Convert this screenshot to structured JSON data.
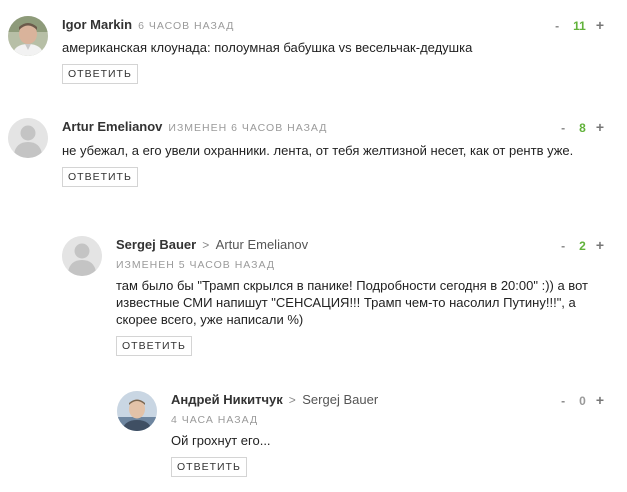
{
  "reply_label": "ОТВЕТИТЬ",
  "colors": {
    "positive": "#61b23a",
    "neutral": "#999999"
  },
  "comments": [
    {
      "author": "Igor Markin",
      "time": "6 ЧАСОВ НАЗАД",
      "text": "американская клоунада: полоумная бабушка vs весельчак-дедушка",
      "score": "11",
      "minus": "-",
      "plus": "+",
      "avatar": "photo"
    },
    {
      "author": "Artur Emelianov",
      "time": "ИЗМЕНЕН 6 ЧАСОВ НАЗАД",
      "text": "не убежал, а его увели охранники. лента, от тебя желтизной несет, как от рентв уже.",
      "score": "8",
      "minus": "-",
      "plus": "+",
      "avatar": "default-user-icon"
    },
    {
      "author": "Sergej Bauer",
      "reply_arrow": ">",
      "reply_to": "Artur Emelianov",
      "time": "ИЗМЕНЕН 5 ЧАСОВ НАЗАД",
      "text": "там было бы \"Трамп скрылся в панике! Подробности сегодня в 20:00\" :)) а вот известные СМИ напишут \"СЕНСАЦИЯ!!! Трамп чем-то насолил Путину!!!\", а скорее всего, уже написали %)",
      "score": "2",
      "minus": "-",
      "plus": "+",
      "avatar": "default-user-icon"
    },
    {
      "author": "Андрей Никитчук",
      "reply_arrow": ">",
      "reply_to": "Sergej Bauer",
      "time": "4 ЧАСА НАЗАД",
      "text": "Ой грохнут его...",
      "score": "0",
      "minus": "-",
      "plus": "+",
      "avatar": "photo"
    }
  ]
}
